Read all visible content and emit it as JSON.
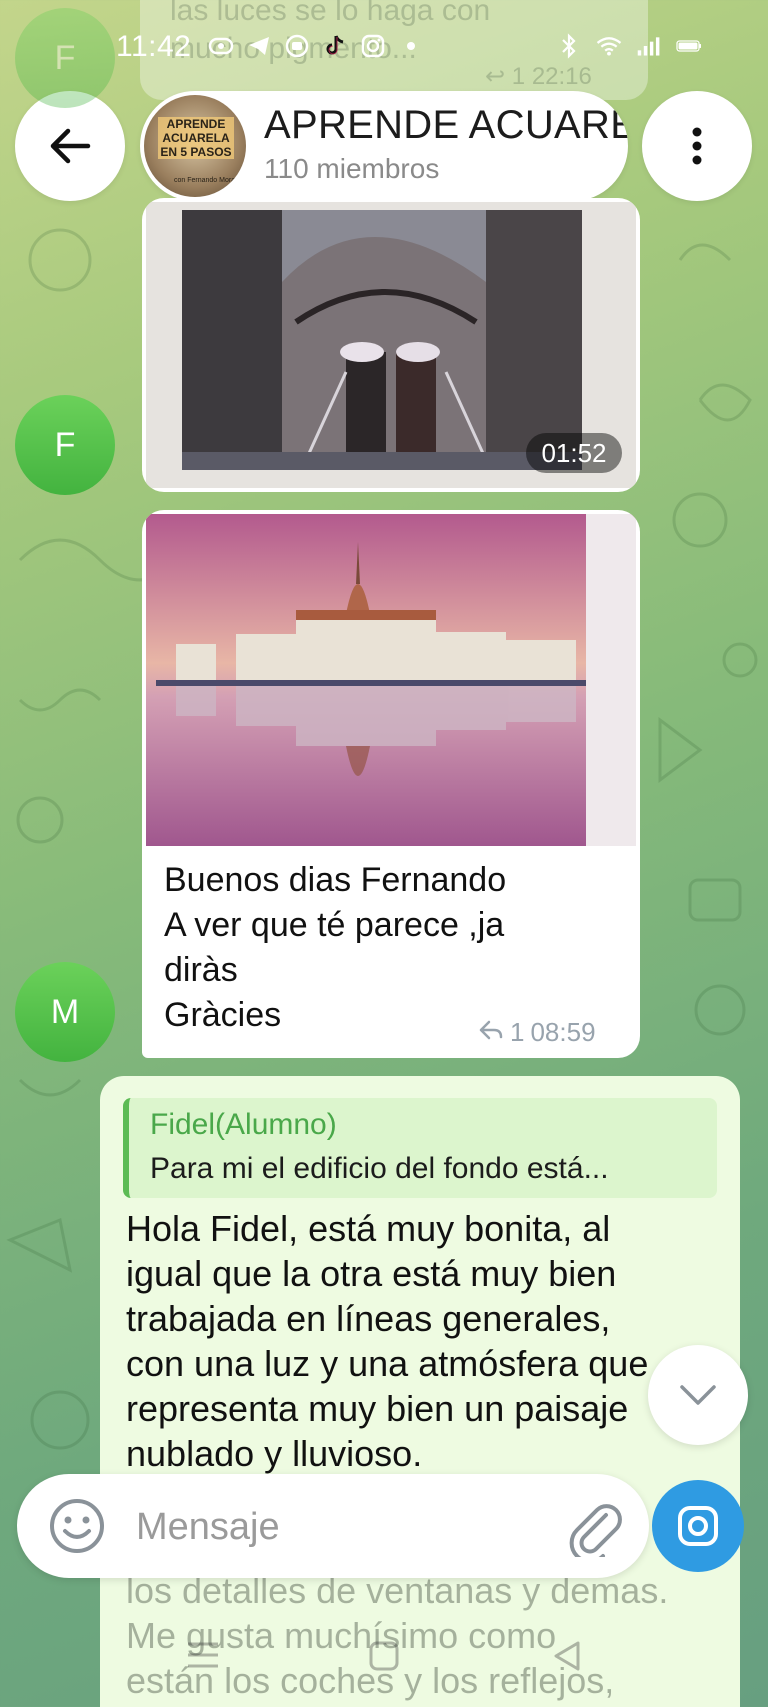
{
  "status_bar": {
    "time": "11:42",
    "icons": [
      "link-icon",
      "telegram-icon",
      "media-icon",
      "tiktok-icon",
      "instagram-icon",
      "dot-icon"
    ],
    "right_icons": [
      "bluetooth-icon",
      "wifi-icon",
      "signal-icon",
      "battery-icon"
    ]
  },
  "previous_message": {
    "text_line1": "las luces se lo haga con",
    "text_line2": "mucho pigmento...",
    "replies": "1",
    "time": "22:16"
  },
  "header": {
    "avatar_text": "APRENDE ACUARELA EN 5 PASOS",
    "avatar_subtext": "con Fernando Mora",
    "title": "APRENDE ACUARELA",
    "members": "110 miembros"
  },
  "messages": [
    {
      "sender_initial": "F",
      "type": "video",
      "duration": "01:52"
    },
    {
      "sender_initial": "M",
      "type": "photo",
      "text_lines": [
        "Buenos dias Fernando",
        "A ver que té parece ,ja",
        "diràs",
        "Gràcies"
      ],
      "replies": "1",
      "time": "08:59"
    }
  ],
  "outgoing": {
    "reply_author": "Fidel(Alumno)",
    "reply_snippet": "Para mi el edificio del fondo está...",
    "text_lines": [
      "Hola Fidel, está muy bonita, al",
      "igual que la otra está muy bien",
      "trabajada en líneas generales,",
      "con una luz y una atmósfera que",
      "representa muy bien un paisaje",
      "nublado y lluvioso."
    ],
    "faded_lines": [
      "los detalles de ventanas y demas.",
      "Me gusta muchísimo como",
      "están los coches y los reflejos,"
    ]
  },
  "composer": {
    "placeholder": "Mensaje"
  },
  "colors": {
    "accent_green": "#4aa84a",
    "camera_blue": "#2f9be2",
    "avatar_green": "#43b33f",
    "outgoing_bubble": "#eefbe1"
  }
}
